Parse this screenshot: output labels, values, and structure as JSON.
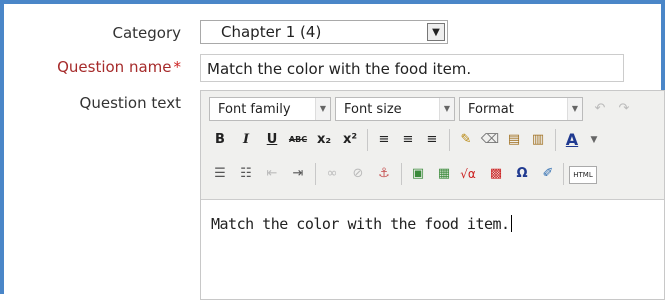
{
  "form": {
    "category": {
      "label": "Category",
      "value": "Chapter 1 (4)"
    },
    "question_name": {
      "label": "Question name",
      "required_mark": "*",
      "value": "Match the color with the food item."
    },
    "question_text": {
      "label": "Question text",
      "editor": {
        "font_family": "Font family",
        "font_size": "Font size",
        "format": "Format",
        "row2": [
          "B",
          "I",
          "U",
          "ABC",
          "x₂",
          "x²"
        ],
        "special_char": "Ω",
        "html_label": "HTML",
        "content": "Match the color with the food item."
      }
    }
  },
  "icons": {
    "select_arrow": "chevron-down-icon",
    "undo": "undo-icon",
    "redo": "redo-icon"
  }
}
